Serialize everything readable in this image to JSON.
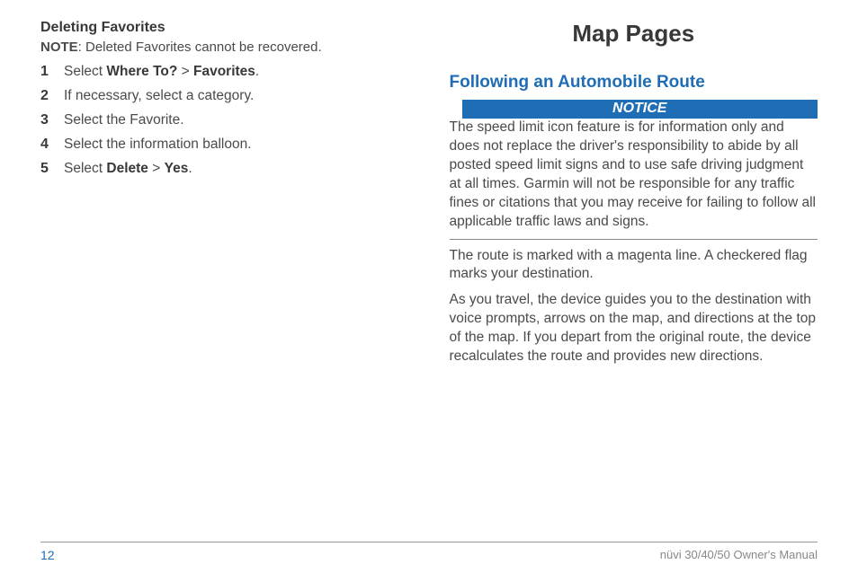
{
  "left": {
    "subsection": "Deleting Favorites",
    "note_label": "NOTE",
    "note_text": ": Deleted Favorites cannot be recovered.",
    "steps": [
      {
        "pre": "Select ",
        "b1": "Where To?",
        "mid": " > ",
        "b2": "Favorites",
        "post": "."
      },
      {
        "pre": "If necessary, select a category."
      },
      {
        "pre": "Select the Favorite."
      },
      {
        "pre": "Select the information balloon."
      },
      {
        "pre": "Select ",
        "b1": "Delete",
        "mid": " > ",
        "b2": "Yes",
        "post": "."
      }
    ]
  },
  "right": {
    "chapter": "Map Pages",
    "section": "Following an Automobile Route",
    "notice_label": "NOTICE",
    "notice_body": "The speed limit icon feature is for information only and does not replace the driver's responsibility to abide by all posted speed limit signs and to use safe driving judgment at all times. Garmin will not be responsible for any traffic fines or citations that you may receive for failing to follow all applicable traffic laws and signs.",
    "para1": "The route is marked with a magenta line. A checkered flag marks your destination.",
    "para2": "As you travel, the device guides you to the destination with voice prompts, arrows on the map, and directions at the top of the map. If you depart from the original route, the device recalculates the route and provides new directions."
  },
  "footer": {
    "page": "12",
    "manual": "nüvi 30/40/50 Owner's Manual"
  }
}
